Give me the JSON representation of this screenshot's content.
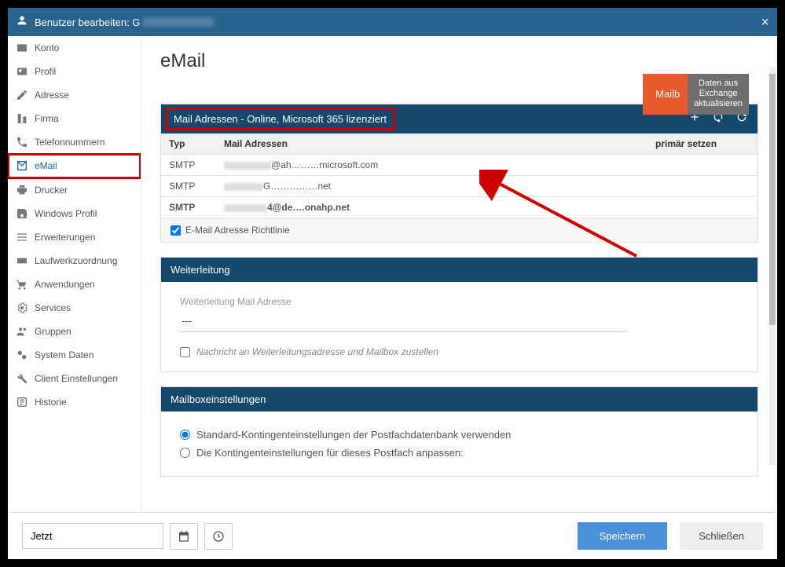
{
  "titlebar": {
    "prefix": "Benutzer bearbeiten: G"
  },
  "sidebar": {
    "items": [
      {
        "label": "Konto",
        "icon": "card"
      },
      {
        "label": "Profil",
        "icon": "card"
      },
      {
        "label": "Adresse",
        "icon": "edit"
      },
      {
        "label": "Firma",
        "icon": "building"
      },
      {
        "label": "Telefonnummern",
        "icon": "phone"
      },
      {
        "label": "eMail",
        "icon": "mail",
        "active": true,
        "boxed": true
      },
      {
        "label": "Drucker",
        "icon": "printer"
      },
      {
        "label": "Windows Profil",
        "icon": "save"
      },
      {
        "label": "Erweiterungen",
        "icon": "list"
      },
      {
        "label": "Laufwerkzuordnung",
        "icon": "drive"
      },
      {
        "label": "Anwendungen",
        "icon": "cart"
      },
      {
        "label": "Services",
        "icon": "gear"
      },
      {
        "label": "Gruppen",
        "icon": "group"
      },
      {
        "label": "System Daten",
        "icon": "gear2"
      },
      {
        "label": "Client Einstellungen",
        "icon": "wrench"
      },
      {
        "label": "Historie",
        "icon": "history"
      }
    ]
  },
  "page": {
    "title": "eMail"
  },
  "topbuttons": {
    "mailbox": "Mailb",
    "exchange": "Daten aus\nExchange\naktualisieren"
  },
  "mailaddresses": {
    "bar_label": "Mail Adressen - Online, Microsoft 365 lizenziert",
    "col_type": "Typ",
    "col_addr": "Mail Adressen",
    "col_primary": "primär setzen",
    "rows": [
      {
        "type": "SMTP",
        "addr_suffix": "@ah………microsoft.com"
      },
      {
        "type": "SMTP",
        "addr_suffix": "G……………net"
      },
      {
        "type": "SMTP",
        "addr_suffix": "4@de….onahp.net",
        "bold": true
      }
    ],
    "policy_label": "E-Mail Adresse Richtlinie",
    "policy_checked": true
  },
  "forwarding": {
    "bar_label": "Weiterleitung",
    "field_label": "Weiterleitung Mail Adresse",
    "field_value": "---",
    "deliver_label": "Nachricht an Weiterleitungsadresse und Mailbox zustellen",
    "deliver_checked": false
  },
  "mailbox_settings": {
    "bar_label": "Mailboxeinstellungen",
    "opt_standard": "Standard-Kontingenteinstellungen der Postfachdatenbank verwenden",
    "opt_custom": "Die Kontingenteinstellungen für dieses Postfach anpassen:",
    "selected": "standard"
  },
  "footer": {
    "date_value": "Jetzt",
    "save": "Speichern",
    "close": "Schließen"
  }
}
